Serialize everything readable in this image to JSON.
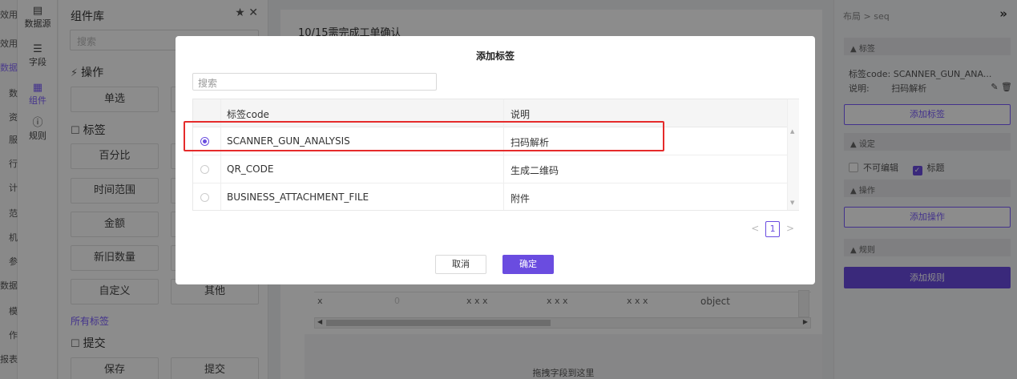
{
  "left_stub": [
    "效用",
    "效用",
    "数据",
    "数",
    "资",
    "服",
    "行",
    "计",
    "范",
    "机",
    "参",
    "数据",
    "模",
    "作",
    "报表"
  ],
  "icon_nav": [
    {
      "icon": "datasource-icon",
      "glyph": "▤",
      "label": "数据源",
      "active": false
    },
    {
      "icon": "list-icon",
      "glyph": "☰",
      "label": "字段",
      "active": false
    },
    {
      "icon": "grid-icon",
      "glyph": "▦",
      "label": "组件",
      "active": true
    },
    {
      "icon": "info-icon",
      "glyph": "ⓘ",
      "label": "规则",
      "active": false
    }
  ],
  "component_library": {
    "title": "组件库",
    "pin_icon": "★",
    "close_icon": "✕",
    "search_placeholder": "搜索",
    "sections": [
      {
        "icon": "⚡",
        "label": "操作"
      },
      {
        "icon": "☐",
        "label": "标签"
      },
      {
        "icon": "☐",
        "label": "提交"
      }
    ],
    "buttons": [
      "单选",
      "百分比",
      "时间范围",
      "金额",
      "新旧数量",
      "自定义",
      "其他",
      "保存",
      "提交"
    ],
    "all_tags_link": "所有标签"
  },
  "canvas": {
    "card_title": "10/15需完成工单确认",
    "table_cells": [
      "x",
      "0",
      "x x x",
      "x x x",
      "x x x",
      "object"
    ],
    "drop_zone_text": "拖拽字段到这里"
  },
  "right_panel": {
    "breadcrumb": "布局 > seq",
    "close_icon": "»",
    "sections": {
      "tags": "▲ 标签",
      "settings": "▲ 设定",
      "actions": "▲ 操作",
      "rules": "▲ 规则"
    },
    "tag_code_label": "标签code:",
    "tag_code_value": "SCANNER_GUN_ANA...",
    "desc_label": "说明:",
    "desc_value": "扫码解析",
    "add_tag_button": "添加标签",
    "not_editable_label": "不可编辑",
    "title_label": "标题",
    "add_action_button": "添加操作",
    "add_rule_button": "添加规则"
  },
  "modal": {
    "title": "添加标签",
    "search_placeholder": "搜索",
    "columns": [
      "标签code",
      "说明"
    ],
    "rows": [
      {
        "code": "SCANNER_GUN_ANALYSIS",
        "desc": "扫码解析",
        "selected": true
      },
      {
        "code": "QR_CODE",
        "desc": "生成二维码",
        "selected": false
      },
      {
        "code": "BUSINESS_ATTACHMENT_FILE",
        "desc": "附件",
        "selected": false
      }
    ],
    "pager": {
      "prev": "<",
      "page": "1",
      "next": ">"
    },
    "cancel_button": "取消",
    "ok_button": "确定"
  },
  "colors": {
    "accent": "#6a4ce0",
    "highlight_border": "#e52b2b",
    "mask": "rgba(0,0,0,0.45)"
  }
}
